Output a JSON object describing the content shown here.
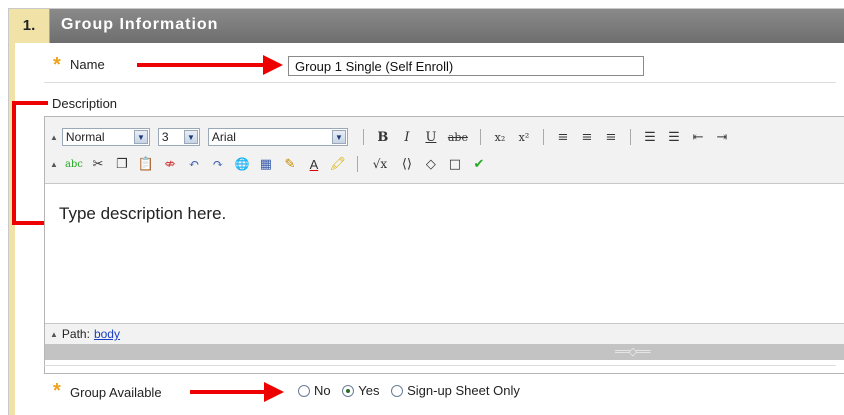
{
  "header": {
    "step": "1.",
    "title": "Group Information"
  },
  "name_field": {
    "label": "Name",
    "value": "Group 1 Single (Self Enroll)"
  },
  "description": {
    "label": "Description",
    "toolbar": {
      "format": "Normal",
      "size": "3",
      "font": "Arial",
      "row1_icons": [
        "B",
        "I",
        "U",
        "abe",
        "x₂",
        "x²",
        "≡",
        "≡",
        "≡",
        "☰",
        "☰",
        "⇤",
        "⇥"
      ],
      "row2_icons": [
        "abc",
        "✂",
        "❐",
        "📋",
        "⇎",
        "↶",
        "↷",
        "🌐",
        "▦",
        "✎",
        "A",
        "🖍",
        "√x",
        "⟨⟩",
        "◇",
        "□",
        "✔"
      ]
    },
    "placeholder": "Type description here.",
    "path_label": "Path:",
    "path_link": "body"
  },
  "availability": {
    "label": "Group Available",
    "options": [
      "No",
      "Yes",
      "Sign-up Sheet Only"
    ],
    "selected": "Yes"
  },
  "colors": {
    "header": "#777777",
    "step_bg": "#f1e3a7",
    "required": "#f0a21c",
    "arrow": "#ee0000"
  }
}
